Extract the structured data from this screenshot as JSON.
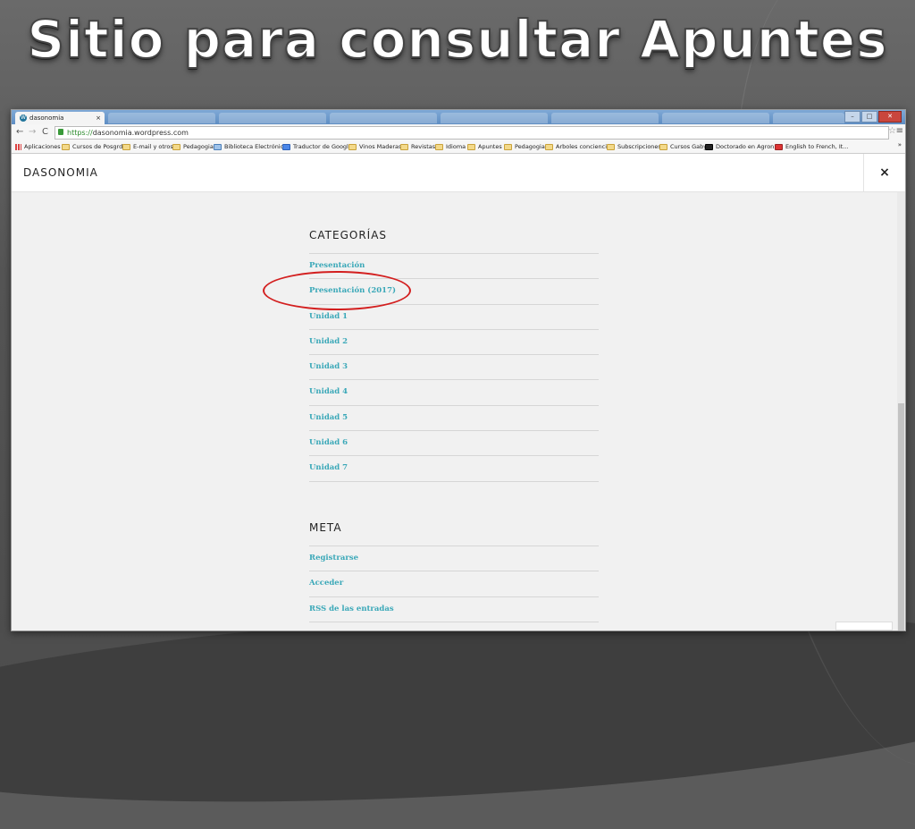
{
  "slide": {
    "title": "Sitio para consultar Apuntes"
  },
  "browser": {
    "tab": {
      "title": "dasonomia",
      "close": "×"
    },
    "window_buttons": [
      "–",
      "□",
      "✕"
    ],
    "nav": {
      "back": "←",
      "forward": "→",
      "reload": "C"
    },
    "address": {
      "scheme": "https://",
      "host": "dasonomia.wordpress.com"
    },
    "star": "☆",
    "menu": "≡",
    "bookmarks": [
      "Aplicaciones",
      "Cursos de Posgrdo",
      "E-mail y otros",
      "Pedagogia",
      "Biblioteca Electrónic...",
      "Traductor de Google",
      "Vinos Maderas",
      "Revistas",
      "Idioma",
      "Apuntes",
      "Pedagogia",
      "Arboles conciencia",
      "Subscripciones",
      "Cursos Gaby",
      "Doctorado en Agron...",
      "English to French, It..."
    ],
    "bookmarks_more": "»"
  },
  "site": {
    "title": "DASONOMIA",
    "close": "×",
    "categories": {
      "title": "CATEGORÍAS",
      "items": [
        "Presentación",
        "Presentación (2017)",
        "Unidad 1",
        "Unidad 2",
        "Unidad 3",
        "Unidad 4",
        "Unidad 5",
        "Unidad 6",
        "Unidad 7"
      ]
    },
    "meta": {
      "title": "META",
      "items": [
        "Registrarse",
        "Acceder",
        "RSS de las entradas"
      ]
    }
  },
  "colors": {
    "link": "#3aa8b8",
    "highlight": "#d31f1f"
  }
}
